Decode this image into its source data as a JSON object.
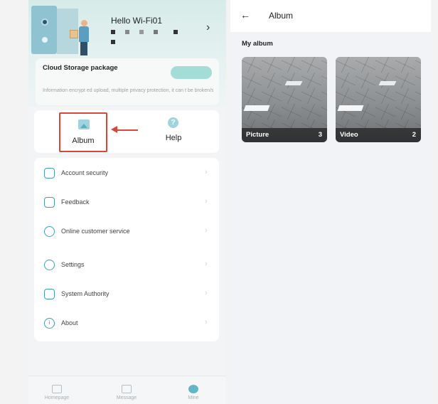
{
  "left": {
    "header": {
      "greeting": "Hello Wi-Fi01"
    },
    "cloud": {
      "title": "Cloud Storage package",
      "description": "Information encrypt ed upload, multiple privacy protection, it can t be broken/stolen, safer to protect data"
    },
    "quick_actions": {
      "album_label": "Album",
      "help_label": "Help"
    },
    "menu": [
      {
        "label": "Account security",
        "icon": "shield-icon"
      },
      {
        "label": "Feedback",
        "icon": "feedback-icon"
      },
      {
        "label": "Online customer service",
        "icon": "headset-icon"
      },
      {
        "label": "Settings",
        "icon": "gear-icon"
      },
      {
        "label": "System Authority",
        "icon": "authority-icon"
      },
      {
        "label": "About",
        "icon": "info-icon"
      }
    ],
    "tabs": [
      {
        "label": "Homepage",
        "icon": "home-icon",
        "active": false
      },
      {
        "label": "Message",
        "icon": "message-icon",
        "active": false
      },
      {
        "label": "Mine",
        "icon": "user-icon",
        "active": true
      }
    ]
  },
  "right": {
    "title": "Album",
    "section_title": "My album",
    "albums": [
      {
        "name": "Picture",
        "count": "3"
      },
      {
        "name": "Video",
        "count": "2"
      }
    ]
  },
  "colors": {
    "accent": "#3f9fb3",
    "highlight": "#d9473a"
  }
}
